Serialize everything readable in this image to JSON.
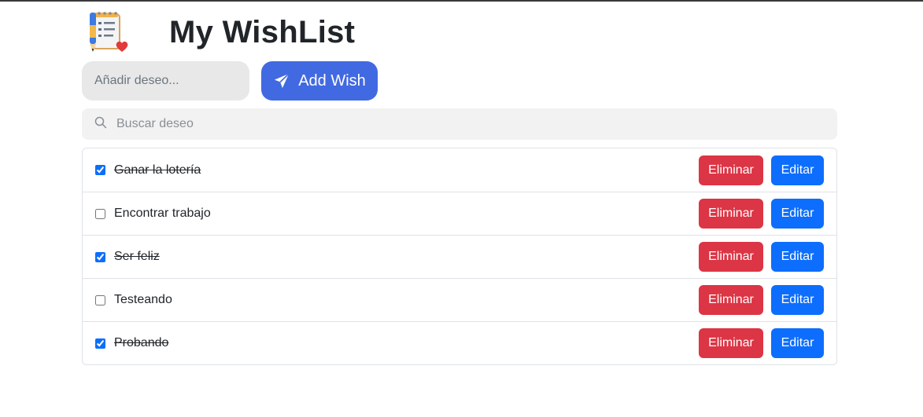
{
  "header": {
    "title": "My WishList",
    "logo_icon": "notepad-pen-heart-icon"
  },
  "add_form": {
    "placeholder": "Añadir deseo...",
    "value": "",
    "button_label": "Add Wish",
    "button_icon": "send-icon"
  },
  "search": {
    "placeholder": "Buscar deseo",
    "value": "",
    "icon": "search-icon"
  },
  "colors": {
    "accent": "#4169e1",
    "delete": "#dc3545",
    "edit": "#0d6efd"
  },
  "wishes": [
    {
      "text": "Ganar la lotería",
      "done": true,
      "delete_label": "Eliminar",
      "edit_label": "Editar"
    },
    {
      "text": "Encontrar trabajo",
      "done": false,
      "delete_label": "Eliminar",
      "edit_label": "Editar"
    },
    {
      "text": "Ser feliz",
      "done": true,
      "delete_label": "Eliminar",
      "edit_label": "Editar"
    },
    {
      "text": "Testeando",
      "done": false,
      "delete_label": "Eliminar",
      "edit_label": "Editar"
    },
    {
      "text": "Probando",
      "done": true,
      "delete_label": "Eliminar",
      "edit_label": "Editar"
    }
  ]
}
